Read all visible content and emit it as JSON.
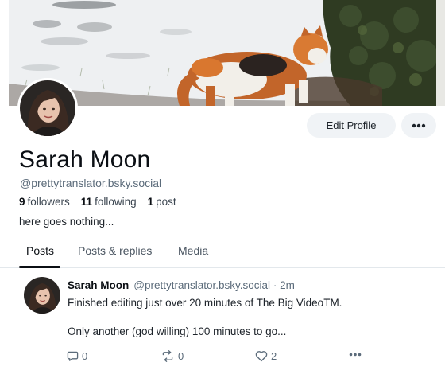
{
  "profile": {
    "display_name": "Sarah Moon",
    "handle": "@prettytranslator.bsky.social",
    "followers_count": "9",
    "followers_label": "followers",
    "following_count": "11",
    "following_label": "following",
    "posts_count": "1",
    "posts_label": "post",
    "bio": "here goes nothing...",
    "edit_button": "Edit Profile",
    "more_icon": "ellipsis-icon"
  },
  "tabs": [
    {
      "label": "Posts",
      "active": true
    },
    {
      "label": "Posts & replies",
      "active": false
    },
    {
      "label": "Media",
      "active": false
    }
  ],
  "post": {
    "author_name": "Sarah Moon",
    "author_handle": "@prettytranslator.bsky.social",
    "separator": "·",
    "time": "2m",
    "text_line1": "Finished editing just over 20 minutes of The Big VideoTM.",
    "text_line2": "Only another (god willing) 100 minutes to go...",
    "reply_count": "0",
    "repost_count": "0",
    "like_count": "2",
    "icons": [
      "reply-icon",
      "repost-icon",
      "like-icon",
      "more-options-icon"
    ]
  },
  "colors": {
    "text_primary": "#0b0f14",
    "text_secondary": "#5b6b7a",
    "button_bg": "#f0f3f6",
    "divider": "#e3e8ec"
  }
}
